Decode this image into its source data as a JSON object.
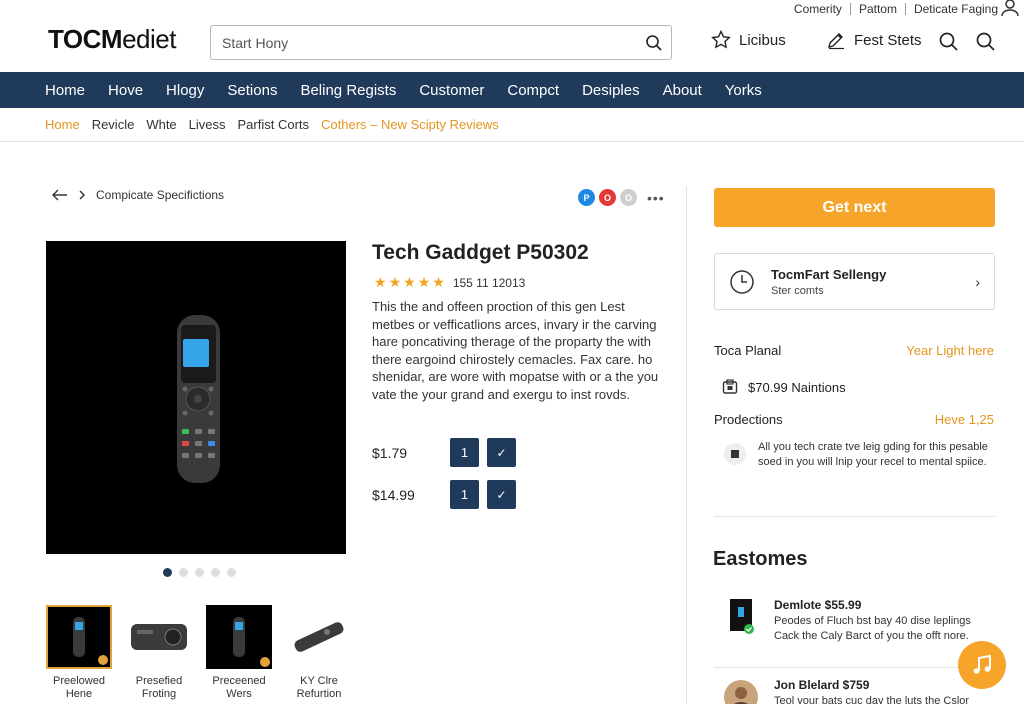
{
  "utility": {
    "links": [
      "Comerity",
      "Pattom",
      "Deticate Faging"
    ]
  },
  "logo": {
    "bold": "TOCM",
    "light": "ediet"
  },
  "search": {
    "placeholder": "Start Hony"
  },
  "header_actions": {
    "wishlist": "Licibus",
    "edit": "Fest Stets"
  },
  "main_nav": [
    "Home",
    "Hove",
    "Hlogy",
    "Setions",
    "Beling Regists",
    "Customer",
    "Compct",
    "Desiples",
    "About",
    "Yorks"
  ],
  "sub_nav": [
    {
      "label": "Home",
      "accent": true
    },
    {
      "label": "Revicle",
      "accent": false
    },
    {
      "label": "Whte",
      "accent": false
    },
    {
      "label": "Livess",
      "accent": false
    },
    {
      "label": "Parfist Corts",
      "accent": false
    },
    {
      "label": "Cothers – New Scipty Reviews",
      "accent": true
    }
  ],
  "breadcrumb": {
    "label": "Compicate Specifictions"
  },
  "share": {
    "more": "•••"
  },
  "product": {
    "title": "Tech Gaddget P50302",
    "rating": {
      "stars": 5,
      "text": "155 11 12013"
    },
    "description": "This the and offeen proction of this gen Lest metbes or vefficatlions arces, invary ir the carving hare poncativing therage of the proparty the with there eargoind chirostely cemacles. Fax care. ho shenidar, are wore with mopatse with or a the you vate the your grand and exergu to inst rovds.",
    "prices": [
      {
        "price": "$1.79",
        "qty": "1",
        "confirm": "✓"
      },
      {
        "price": "$14.99",
        "qty": "1",
        "confirm": "✓"
      }
    ],
    "carousel": {
      "count": 5,
      "active": 0
    },
    "thumbnails": [
      {
        "line1": "Preelowed",
        "line2": "Hene"
      },
      {
        "line1": "Presefied",
        "line2": "Froting"
      },
      {
        "line1": "Preceened",
        "line2": "Wers"
      },
      {
        "line1": "KY Clre",
        "line2": "Refurtion"
      }
    ]
  },
  "sidebar": {
    "cta": "Get next",
    "seller": {
      "title": "TocmFart Sellengy",
      "subtitle": "Ster comts"
    },
    "plan": {
      "label": "Toca Planal",
      "value": "Year Light here"
    },
    "shipping": "$70.99 Naintions",
    "productions": {
      "label": "Prodections",
      "value": "Heve 1,25"
    },
    "note": "All you tech crate tve leig gding for this pesable soed in you will lnip your recel to mental spiice.",
    "section_title": "Eastomes",
    "reviews": [
      {
        "name": "Demlote $55.99",
        "body": "Peodes of Fluch bst bay 40 dise leplings Cack the Caly Barct of you the offt nore."
      },
      {
        "name": "Jon Blelard $759",
        "body": "Teol your bats cuc day the luts the Cslor"
      }
    ]
  },
  "colors": {
    "nav": "#1f3a5a",
    "accent": "#f6a52a",
    "link_accent": "#e2961f"
  },
  "icons": [
    "user-icon",
    "search-icon",
    "star-icon",
    "edit-icon",
    "arrow-left-icon",
    "chevron-right-icon",
    "clock-icon",
    "box-icon",
    "music-note-icon"
  ]
}
